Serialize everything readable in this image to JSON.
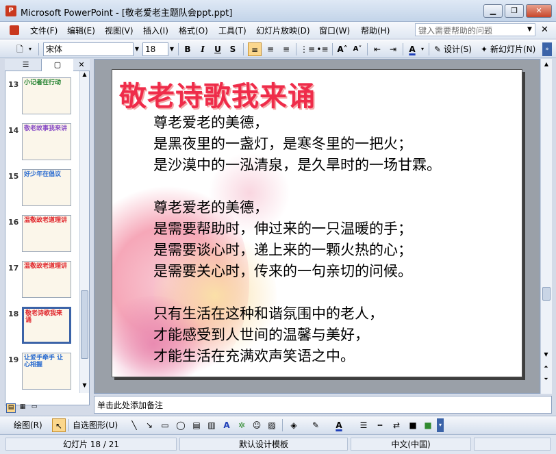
{
  "window": {
    "title": "Microsoft PowerPoint - [敬老爱老主题队会ppt.ppt]",
    "app_icon": "P"
  },
  "menu": [
    "文件(F)",
    "编辑(E)",
    "视图(V)",
    "插入(I)",
    "格式(O)",
    "工具(T)",
    "幻灯片放映(D)",
    "窗口(W)",
    "帮助(H)"
  ],
  "help_placeholder": "键入需要帮助的问题",
  "toolbar": {
    "font": "宋体",
    "size": "18",
    "design": "设计(S)",
    "new_slide": "新幻灯片(N)"
  },
  "thumbnails": [
    {
      "num": "13",
      "text": "小记者在行动",
      "color": "#1e7f2c"
    },
    {
      "num": "14",
      "text": "敬老故事我来讲",
      "color": "#8a4fc7"
    },
    {
      "num": "15",
      "text": "好少年在倡议",
      "color": "#2f6fd1"
    },
    {
      "num": "16",
      "text": "温敬故老道理讲",
      "color": "#e0262c"
    },
    {
      "num": "17",
      "text": "温敬故老道理讲",
      "color": "#e0262c"
    },
    {
      "num": "18",
      "text": "敬老诗歌我来诵",
      "color": "#e0262c"
    },
    {
      "num": "19",
      "text": "让爱手牵手 让心相握",
      "color": "#2f6fd1"
    }
  ],
  "slide": {
    "title": "敬老诗歌我来诵",
    "lines": [
      "尊老爱老的美德，",
      "是黑夜里的一盏灯，是寒冬里的一把火；",
      "是沙漠中的一泓清泉，是久旱时的一场甘霖。",
      "",
      "尊老爱老的美德，",
      "是需要帮助时，伸过来的一只温暖的手；",
      "是需要谈心时，递上来的一颗火热的心；",
      "是需要关心时，传来的一句亲切的问候。",
      "",
      "只有生活在这种和谐氛围中的老人，",
      "才能感受到人世间的温馨与美好，",
      "才能生活在充满欢声笑语之中。"
    ]
  },
  "notes_placeholder": "单击此处添加备注",
  "drawbar": {
    "draw": "绘图(R)",
    "autoshape": "自选图形(U)"
  },
  "status": {
    "slide": "幻灯片 18 / 21",
    "template": "默认设计模板",
    "language": "中文(中国)"
  }
}
